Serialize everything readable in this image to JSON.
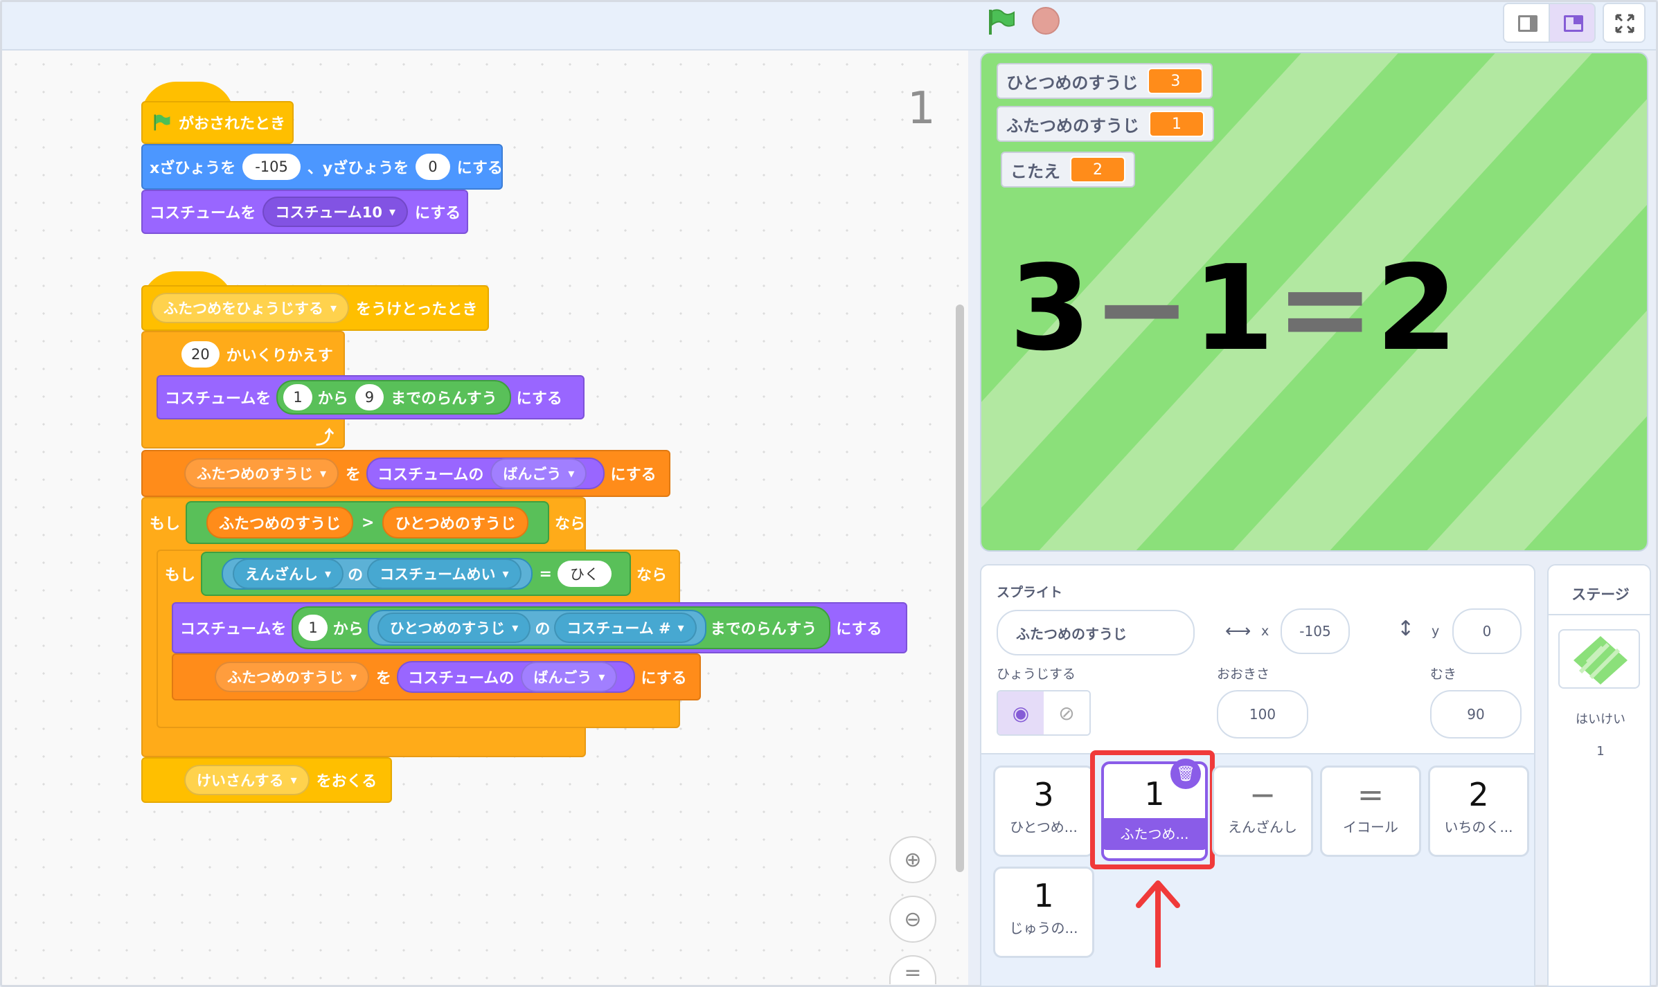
{
  "code": {
    "sprite_number": "1",
    "script1": {
      "hat": "がおされたとき",
      "goto_x_label": "xざひょうを",
      "goto_x": "-105",
      "goto_y_label": "、yざひょうを",
      "goto_y": "0",
      "goto_suffix": "にする",
      "costume_label": "コスチュームを",
      "costume_value": "コスチューム10",
      "costume_suffix": "にする"
    },
    "script2": {
      "hat_msg": "ふたつめをひょうじする",
      "hat_suffix": "をうけとったとき",
      "repeat_count": "20",
      "repeat_label": "かいくりかえす",
      "rand_costume_label": "コスチュームを",
      "rand_from": "1",
      "rand_kara": "から",
      "rand_to": "9",
      "rand_made": "までのらんすう",
      "rand_suffix": "にする",
      "setvar_var": "ふたつめのすうじ",
      "setvar_wo": "を",
      "costume_of": "コスチュームの",
      "costume_number": "ばんごう",
      "setvar_suffix": "にする",
      "if1_label": "もし",
      "if1_left": "ふたつめのすうじ",
      "if1_op": ">",
      "if1_right": "ひとつめのすうじ",
      "if1_nara": "なら",
      "if2_label": "もし",
      "if2_sprite": "えんざんし",
      "if2_no": "の",
      "if2_prop": "コスチュームめい",
      "if2_eq": "=",
      "if2_value": "ひく",
      "if2_nara": "なら",
      "rand2_label": "コスチュームを",
      "rand2_from": "1",
      "rand2_kara": "から",
      "rand2_sprite": "ひとつめのすうじ",
      "rand2_no": "の",
      "rand2_prop": "コスチューム #",
      "rand2_made": "までのらんすう",
      "rand2_suffix": "にする",
      "set2_var": "ふたつめのすうじ",
      "set2_wo": "を",
      "set2_costume_of": "コスチュームの",
      "set2_number": "ばんごう",
      "set2_suffix": "にする",
      "broadcast_msg": "けいさんする",
      "broadcast_suffix": "をおくる"
    }
  },
  "stage": {
    "monitors": [
      {
        "label": "ひとつめのすうじ",
        "value": "3"
      },
      {
        "label": "ふたつめのすうじ",
        "value": "1"
      },
      {
        "label": "こたえ",
        "value": "2"
      }
    ],
    "equation": {
      "a": "3",
      "op": "−",
      "b": "1",
      "eq": "=",
      "c": "2"
    }
  },
  "sprite_info": {
    "title": "スプライト",
    "name": "ふたつめのすうじ",
    "x_label": "x",
    "x": "-105",
    "y_label": "y",
    "y": "0",
    "show_label": "ひょうじする",
    "size_label": "おおきさ",
    "size": "100",
    "direction_label": "むき",
    "direction": "90"
  },
  "sprites": [
    {
      "costume": "3",
      "name": "ひとつめ..."
    },
    {
      "costume": "1",
      "name": "ふたつめ..."
    },
    {
      "costume": "−",
      "name": "えんざんし"
    },
    {
      "costume": "=",
      "name": "イコール"
    },
    {
      "costume": "2",
      "name": "いちのく..."
    },
    {
      "costume": "1",
      "name": "じゅうの..."
    }
  ],
  "stage_panel": {
    "title": "ステージ",
    "backdrop_label": "はいけい",
    "backdrop_count": "1"
  },
  "colors": {
    "highlight": "#f03a3a",
    "selected": "#8a5ce8",
    "stage_green": "#8ee07a"
  }
}
